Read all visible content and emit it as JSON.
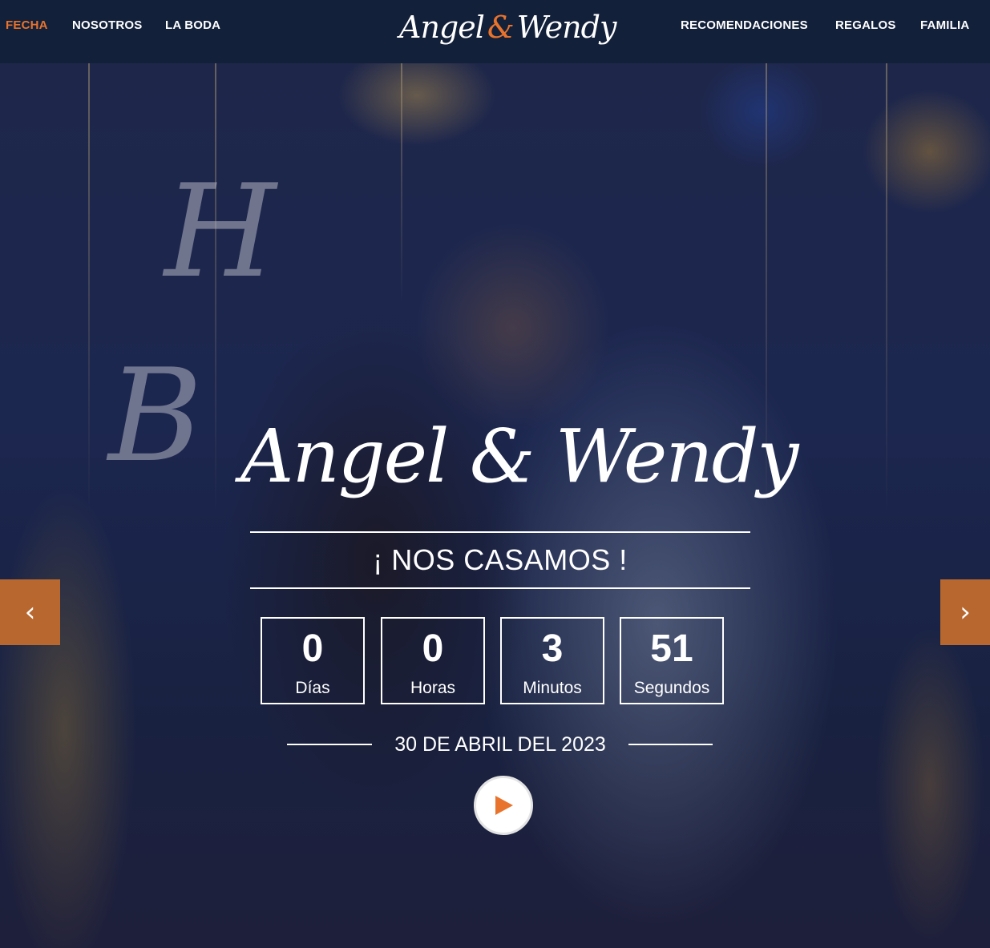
{
  "nav": {
    "left": [
      "FECHA",
      "NOSOTROS",
      "LA BODA"
    ],
    "right": [
      "RECOMENDACIONES",
      "REGALOS",
      "FAMILIA"
    ],
    "active": "FECHA",
    "logo": {
      "first": "Angel",
      "amp": "&",
      "second": "Wendy"
    }
  },
  "hero": {
    "title": "Angel & Wendy",
    "subtitle": "¡ NOS CASAMOS !",
    "countdown": [
      {
        "value": "0",
        "label": "Días"
      },
      {
        "value": "0",
        "label": "Horas"
      },
      {
        "value": "3",
        "label": "Minutos"
      },
      {
        "value": "51",
        "label": "Segundos"
      }
    ],
    "date": "30 DE ABRIL DEL 2023",
    "prev_icon": "‹",
    "next_icon": "›",
    "play_icon": "play-icon"
  },
  "colors": {
    "accent": "#e8732c",
    "nav_bg": "#13203a",
    "arrow_bg": "#b8672e"
  }
}
